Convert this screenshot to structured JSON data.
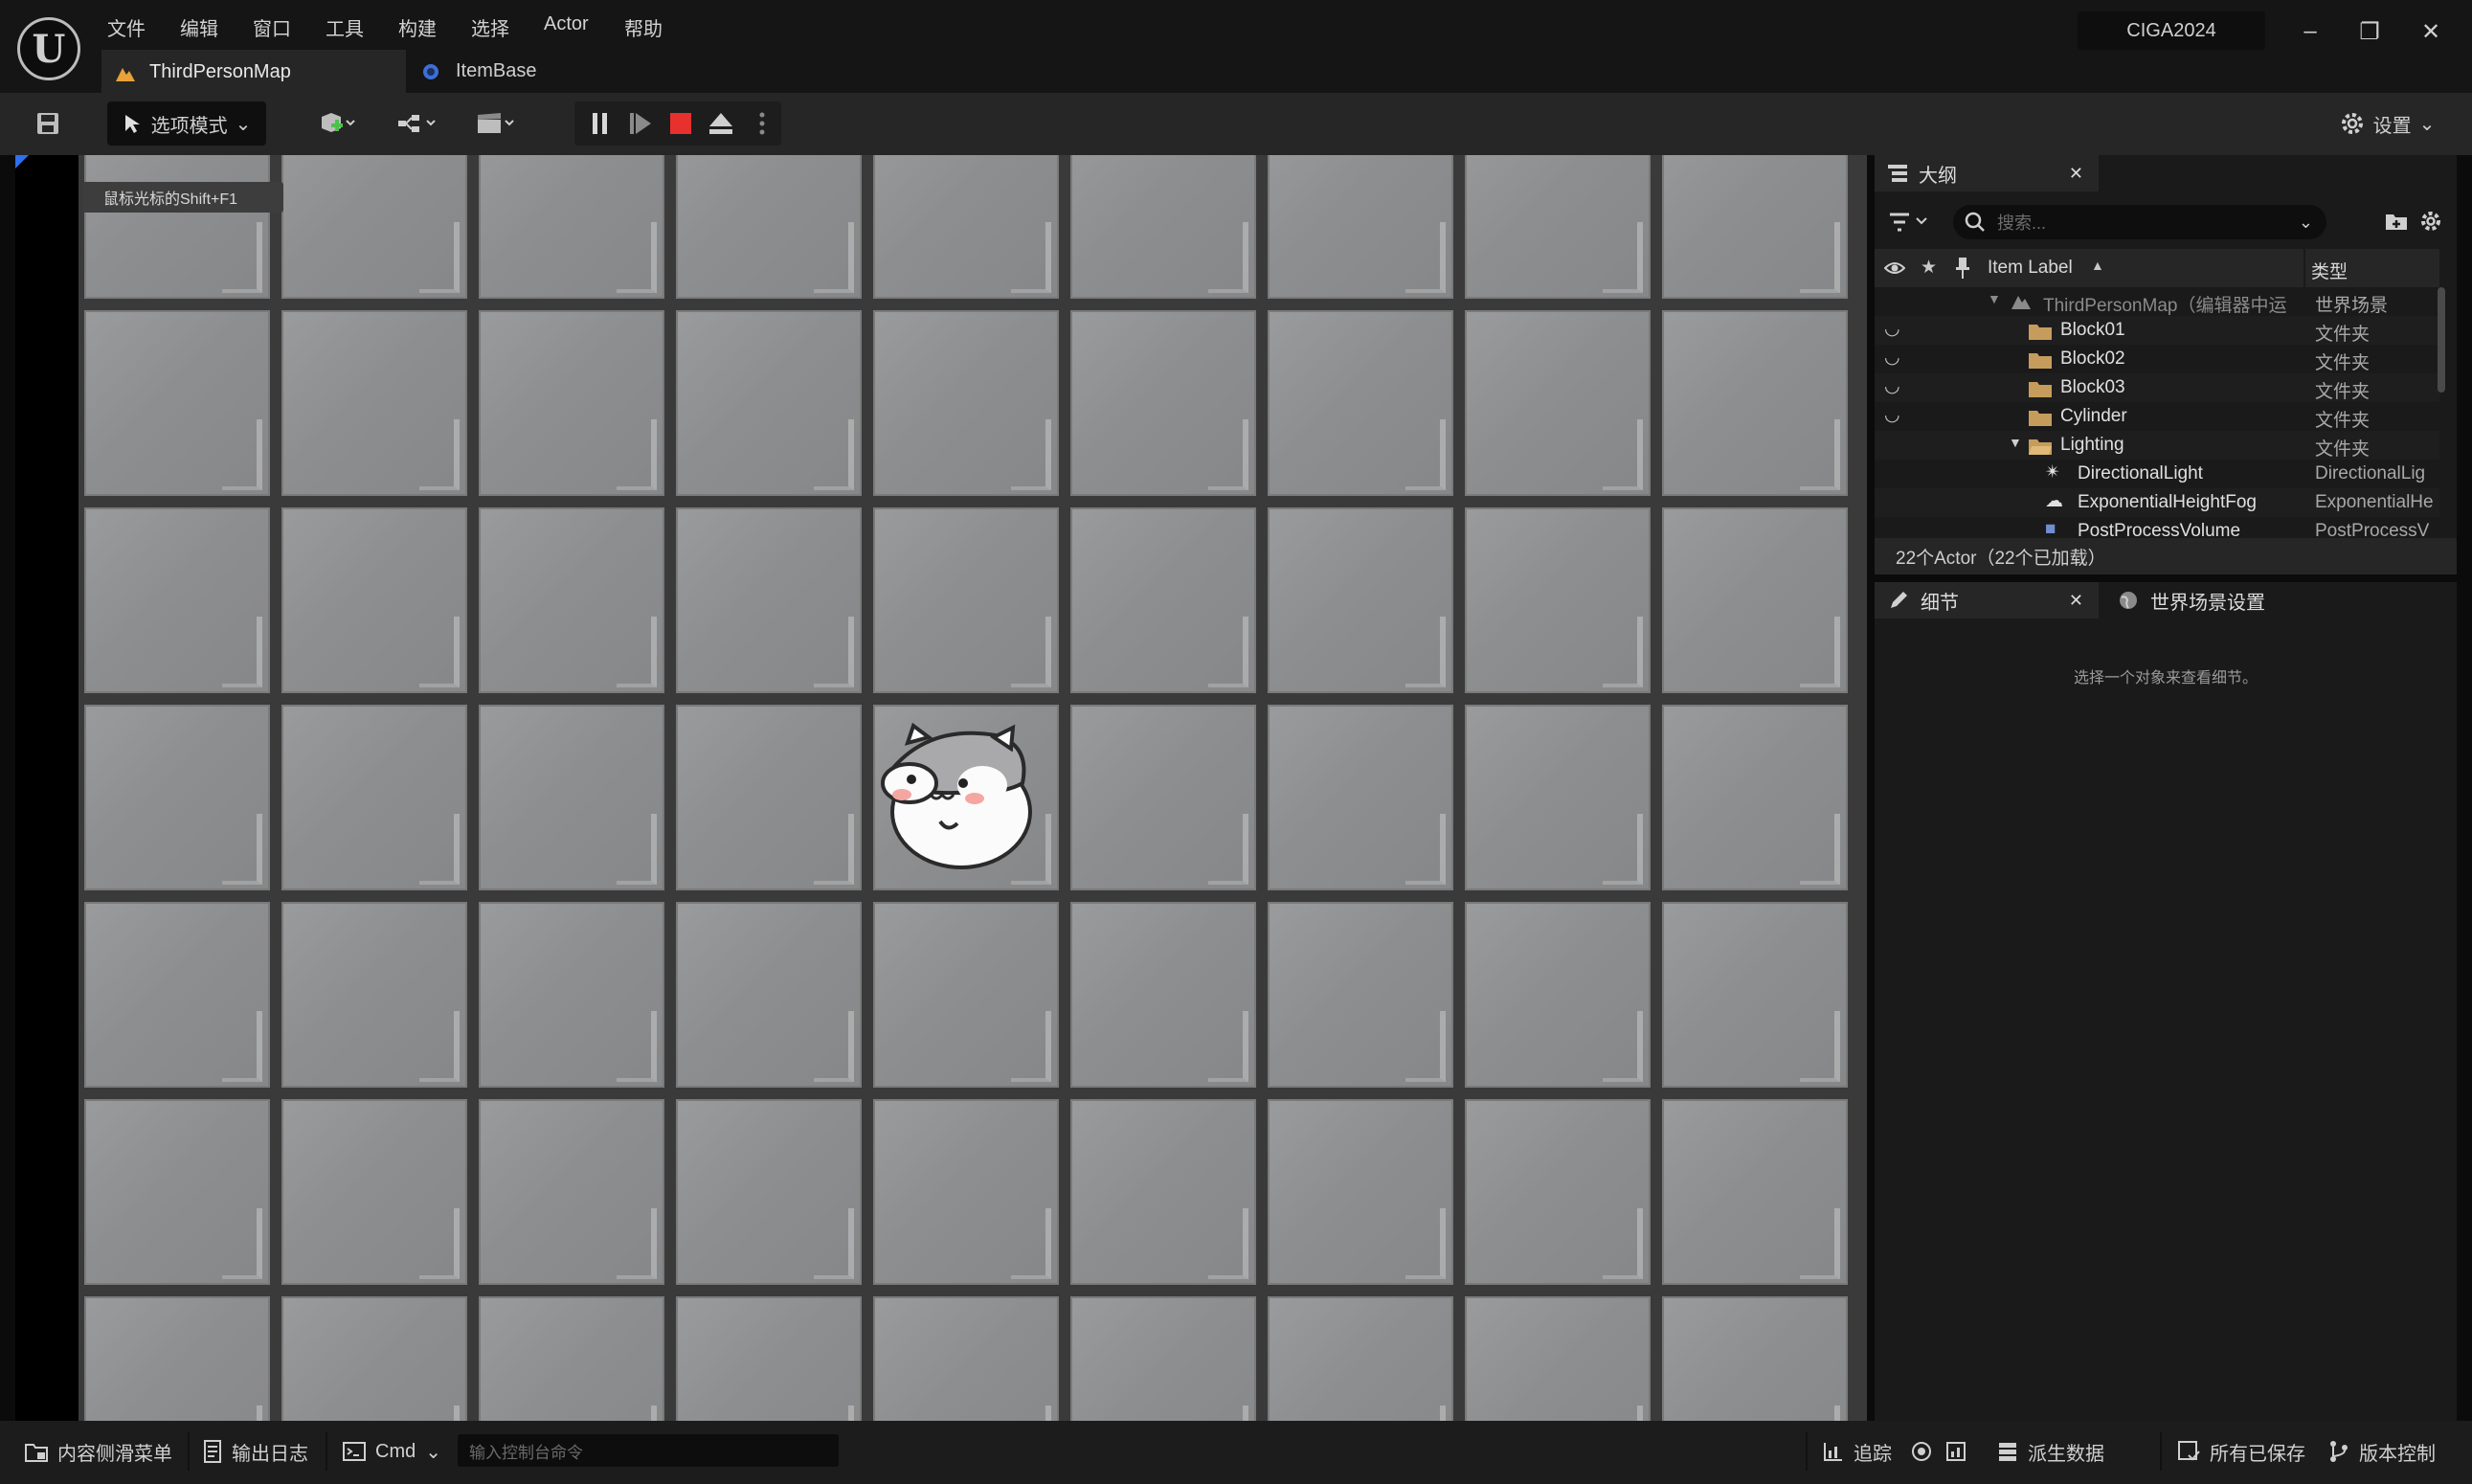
{
  "menu": [
    "文件",
    "编辑",
    "窗口",
    "工具",
    "构建",
    "选择",
    "Actor",
    "帮助"
  ],
  "tabs": [
    {
      "label": "ThirdPersonMap",
      "icon": "map-icon"
    },
    {
      "label": "ItemBase",
      "icon": "blueprint-icon"
    }
  ],
  "project_name": "CIGA2024",
  "toolbar": {
    "mode_label": "选项模式",
    "settings_label": "设置"
  },
  "viewport": {
    "hint": "鼠标光标的Shift+F1"
  },
  "outliner": {
    "title": "大纲",
    "search_placeholder": "搜索...",
    "col_label": "Item Label",
    "col_type": "类型",
    "rows": [
      {
        "name": "ThirdPersonMap（编辑器中运",
        "type": "世界场景"
      },
      {
        "name": "Block01",
        "type": "文件夹"
      },
      {
        "name": "Block02",
        "type": "文件夹"
      },
      {
        "name": "Block03",
        "type": "文件夹"
      },
      {
        "name": "Cylinder",
        "type": "文件夹"
      },
      {
        "name": "Lighting",
        "type": "文件夹"
      },
      {
        "name": "DirectionalLight",
        "type": "DirectionalLig"
      },
      {
        "name": "ExponentialHeightFog",
        "type": "ExponentialHe"
      },
      {
        "name": "PostProcessVolume",
        "type": "PostProcessV"
      }
    ],
    "footer": "22个Actor（22个已加载）"
  },
  "details": {
    "title": "细节",
    "world_settings": "世界场景设置",
    "empty_text": "选择一个对象来查看细节。"
  },
  "statusbar": {
    "content_drawer": "内容侧滑菜单",
    "output_log": "输出日志",
    "cmd": "Cmd",
    "console_placeholder": "输入控制台命令",
    "trace": "追踪",
    "derived_data": "派生数据",
    "all_saved": "所有已保存",
    "source_control": "版本控制"
  },
  "colors": {
    "stop_button": "#e8302e",
    "tile": "#909193",
    "grid_line": "#3a3a3a",
    "panel": "#1a1a1a"
  }
}
